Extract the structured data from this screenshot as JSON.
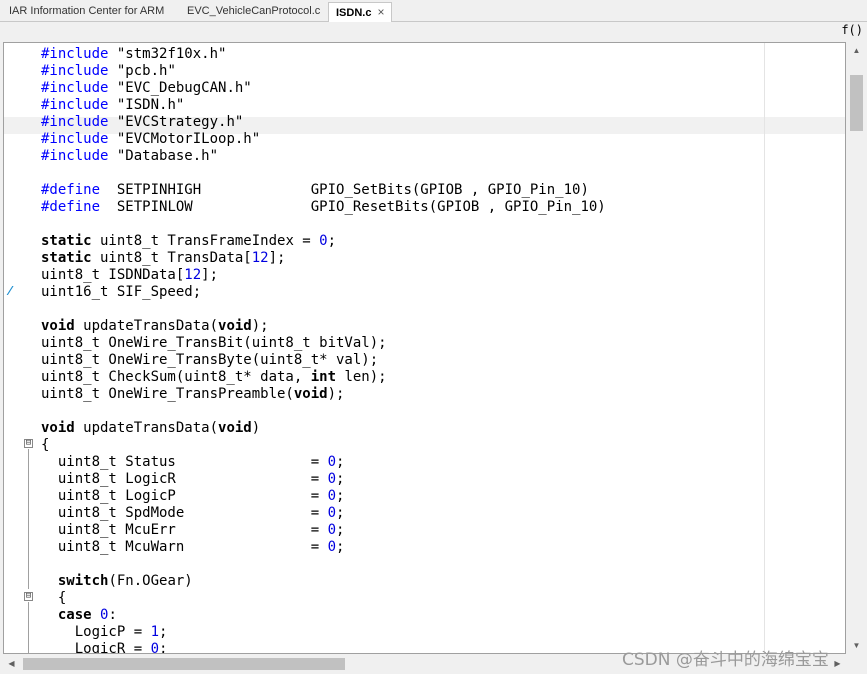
{
  "tabs": [
    {
      "label": "IAR Information Center for ARM",
      "active": false
    },
    {
      "label": "EVC_VehicleCanProtocol.c",
      "active": false
    },
    {
      "label": "ISDN.c",
      "active": true,
      "close": "×"
    }
  ],
  "toolbar": {
    "function_button": "f()"
  },
  "code_lines": [
    [
      {
        "t": "#include",
        "c": "pp"
      },
      {
        "t": " \"stm32f10x.h\""
      }
    ],
    [
      {
        "t": "#include",
        "c": "pp"
      },
      {
        "t": " \"pcb.h\""
      }
    ],
    [
      {
        "t": "#include",
        "c": "pp"
      },
      {
        "t": " \"EVC_DebugCAN.h\""
      }
    ],
    [
      {
        "t": "#include",
        "c": "pp"
      },
      {
        "t": " \"ISDN.h\""
      }
    ],
    [
      {
        "t": "#include",
        "c": "pp"
      },
      {
        "t": " \"EVCStrategy.h\""
      }
    ],
    [
      {
        "t": "#include",
        "c": "pp"
      },
      {
        "t": " \"EVCMotorILoop.h\""
      }
    ],
    [
      {
        "t": "#include",
        "c": "pp"
      },
      {
        "t": " \"Database.h\""
      }
    ],
    [],
    [
      {
        "t": "#define",
        "c": "pp"
      },
      {
        "t": "  SETPINHIGH             GPIO_SetBits(GPIOB , GPIO_Pin_10)"
      }
    ],
    [
      {
        "t": "#define",
        "c": "pp"
      },
      {
        "t": "  SETPINLOW              GPIO_ResetBits(GPIOB , GPIO_Pin_10)"
      }
    ],
    [],
    [
      {
        "t": "static",
        "c": "kw"
      },
      {
        "t": " uint8_t TransFrameIndex = "
      },
      {
        "t": "0",
        "c": "num"
      },
      {
        "t": ";"
      }
    ],
    [
      {
        "t": "static",
        "c": "kw"
      },
      {
        "t": " uint8_t TransData["
      },
      {
        "t": "12",
        "c": "num"
      },
      {
        "t": "];"
      }
    ],
    [
      {
        "t": "uint8_t ISDNData["
      },
      {
        "t": "12",
        "c": "num"
      },
      {
        "t": "];"
      }
    ],
    [
      {
        "t": "uint16_t SIF_Speed;"
      }
    ],
    [],
    [
      {
        "t": "void",
        "c": "kw"
      },
      {
        "t": " updateTransData("
      },
      {
        "t": "void",
        "c": "kw"
      },
      {
        "t": ");"
      }
    ],
    [
      {
        "t": "uint8_t OneWire_TransBit(uint8_t bitVal);"
      }
    ],
    [
      {
        "t": "uint8_t OneWire_TransByte(uint8_t* val);"
      }
    ],
    [
      {
        "t": "uint8_t CheckSum(uint8_t* data, "
      },
      {
        "t": "int",
        "c": "kw"
      },
      {
        "t": " len);"
      }
    ],
    [
      {
        "t": "uint8_t OneWire_TransPreamble("
      },
      {
        "t": "void",
        "c": "kw"
      },
      {
        "t": ");"
      }
    ],
    [],
    [
      {
        "t": "void",
        "c": "kw"
      },
      {
        "t": " updateTransData("
      },
      {
        "t": "void",
        "c": "kw"
      },
      {
        "t": ")"
      }
    ],
    [
      {
        "t": "{"
      }
    ],
    [
      {
        "t": "  uint8_t Status                = "
      },
      {
        "t": "0",
        "c": "num"
      },
      {
        "t": ";"
      }
    ],
    [
      {
        "t": "  uint8_t LogicR                = "
      },
      {
        "t": "0",
        "c": "num"
      },
      {
        "t": ";"
      }
    ],
    [
      {
        "t": "  uint8_t LogicP                = "
      },
      {
        "t": "0",
        "c": "num"
      },
      {
        "t": ";"
      }
    ],
    [
      {
        "t": "  uint8_t SpdMode               = "
      },
      {
        "t": "0",
        "c": "num"
      },
      {
        "t": ";"
      }
    ],
    [
      {
        "t": "  uint8_t McuErr                = "
      },
      {
        "t": "0",
        "c": "num"
      },
      {
        "t": ";"
      }
    ],
    [
      {
        "t": "  uint8_t McuWarn               = "
      },
      {
        "t": "0",
        "c": "num"
      },
      {
        "t": ";"
      }
    ],
    [],
    [
      {
        "t": "  "
      },
      {
        "t": "switch",
        "c": "kw"
      },
      {
        "t": "(Fn.OGear)"
      }
    ],
    [
      {
        "t": "  {"
      }
    ],
    [
      {
        "t": "  "
      },
      {
        "t": "case",
        "c": "kw"
      },
      {
        "t": " "
      },
      {
        "t": "0",
        "c": "num"
      },
      {
        "t": ":"
      }
    ],
    [
      {
        "t": "    LogicP = "
      },
      {
        "t": "1",
        "c": "num"
      },
      {
        "t": ";"
      }
    ],
    [
      {
        "t": "    LogicR = "
      },
      {
        "t": "0",
        "c": "num"
      },
      {
        "t": ";"
      }
    ]
  ],
  "fold_markers": [
    "⊟",
    "⊟"
  ],
  "watermark": "CSDN @奋斗中的海绵宝宝",
  "scroll_arrows": {
    "up": "▲",
    "down": "▼",
    "left": "◀",
    "right": "▶"
  }
}
